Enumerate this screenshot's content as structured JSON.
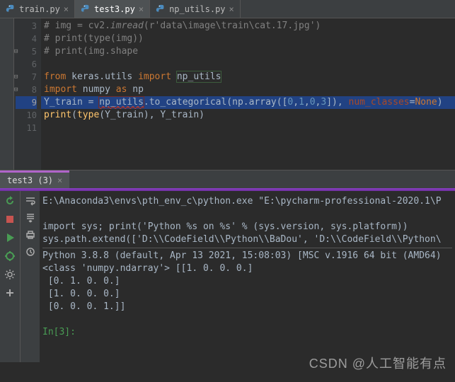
{
  "tabs": [
    {
      "label": "train.py",
      "active": false
    },
    {
      "label": "test3.py",
      "active": true
    },
    {
      "label": "np_utils.py",
      "active": false
    }
  ],
  "gutter": [
    "3",
    "4",
    "5",
    "6",
    "7",
    "8",
    "9",
    "10",
    "11"
  ],
  "code": {
    "l3": {
      "a": "# img = cv2.",
      "b": "imread",
      "c": "(",
      "d": "r'data\\image\\train\\cat.17.jpg'",
      "e": ")"
    },
    "l4": "# print(type(img))",
    "l5": "# print(img.shape",
    "l7": {
      "a": "from ",
      "b": "keras.utils ",
      "c": "import ",
      "d": "np_utils"
    },
    "l8": {
      "a": "import ",
      "b": "numpy ",
      "c": "as ",
      "d": "np"
    },
    "l9": {
      "a": "Y_train = ",
      "b": "np_utils",
      "c": ".to_categorical(np.array([",
      "n0": "0",
      "com": ",",
      "n1": "1",
      "n2": "0",
      "n3": "3",
      "d": "]), ",
      "e": "num_classes",
      "f": "=",
      "g": "None",
      "h": ")"
    },
    "l10": {
      "a": "print",
      "b": "(",
      "c": "type",
      "d": "(Y_train), Y_train)"
    }
  },
  "termTab": "test3 (3)",
  "console": {
    "l1": "E:\\Anaconda3\\envs\\pth_env_c\\python.exe \"E:\\pycharm-professional-2020.1\\P",
    "l2": "import sys; print('Python %s on %s' % (sys.version, sys.platform))",
    "l3": "sys.path.extend(['D:\\\\CodeField\\\\Python\\\\BaDou', 'D:\\\\CodeField\\\\Python\\",
    "l4": "Python 3.8.8 (default, Apr 13 2021, 15:08:03) [MSC v.1916 64 bit (AMD64)",
    "l5": "<class 'numpy.ndarray'> [[1. 0. 0. 0.]",
    "l6": " [0. 1. 0. 0.]",
    "l7": " [1. 0. 0. 0.]",
    "l8": " [0. 0. 0. 1.]]",
    "prompt": "In[3]:"
  },
  "watermark": "CSDN @人工智能有点"
}
